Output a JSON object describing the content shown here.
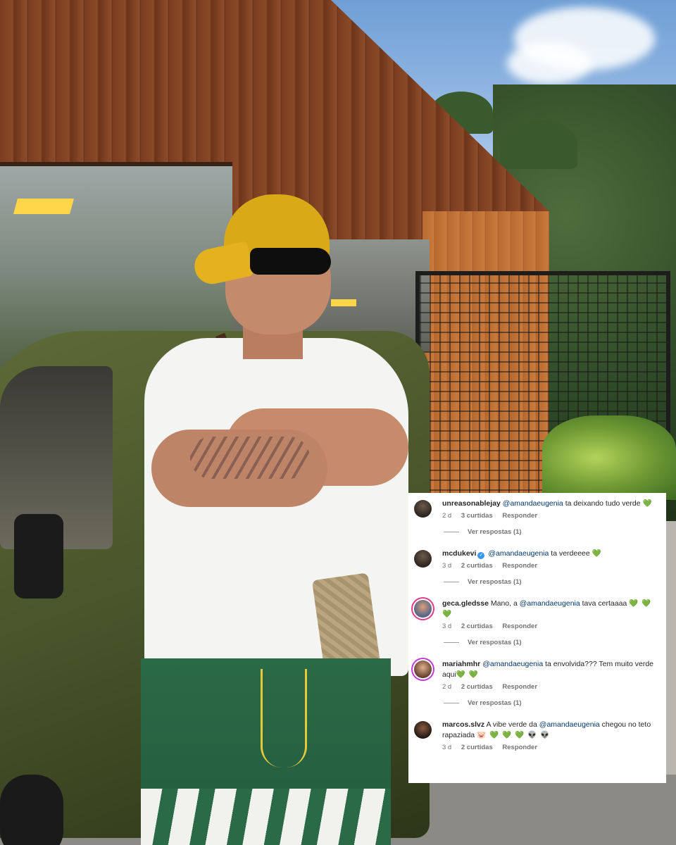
{
  "comments": [
    {
      "username": "unreasonablejay",
      "verified": false,
      "mention": "@amandaeugenia",
      "text": " ta deixando tudo verde",
      "emojis": "💚",
      "time": "2 d",
      "likes": "3 curtidas",
      "reply_label": "Responder",
      "view_replies": "Ver respostas (1)"
    },
    {
      "username": "mcdukevi",
      "verified": true,
      "mention": "@amandaeugenia",
      "text": " ta verdeeee",
      "emojis": "💚",
      "time": "3 d",
      "likes": "2 curtidas",
      "reply_label": "Responder",
      "view_replies": "Ver respostas (1)"
    },
    {
      "username": "geca.gledsse",
      "verified": false,
      "prefix": "Mano, a ",
      "mention": "@amandaeugenia",
      "text": " tava certaaaa",
      "emojis": "💚 💚 💚",
      "time": "3 d",
      "likes": "2 curtidas",
      "reply_label": "Responder",
      "view_replies": "Ver respostas (1)"
    },
    {
      "username": "mariahmhr",
      "verified": false,
      "mention": "@amandaeugenia",
      "text": " ta envolvida??? Tem muito verde aqui",
      "emojis": "💚 💚",
      "time": "2 d",
      "likes": "2 curtidas",
      "reply_label": "Responder",
      "view_replies": "Ver respostas (1)"
    },
    {
      "username": "marcos.slvz",
      "verified": false,
      "prefix": "A vibe verde da ",
      "mention": "@amandaeugenia",
      "text": " chegou no teto rapaziada",
      "emojis": "🐷 💚 💚 💚 👽 👽",
      "time": "3 d",
      "likes": "2 curtidas",
      "reply_label": "Responder"
    }
  ],
  "colors": {
    "mention": "#00376b",
    "heart": "#2fb45a",
    "meta": "#737373",
    "panel_bg": "#ffffff"
  },
  "icons": {
    "verified": "verified-badge-icon",
    "heart": "green-heart-emoji"
  }
}
